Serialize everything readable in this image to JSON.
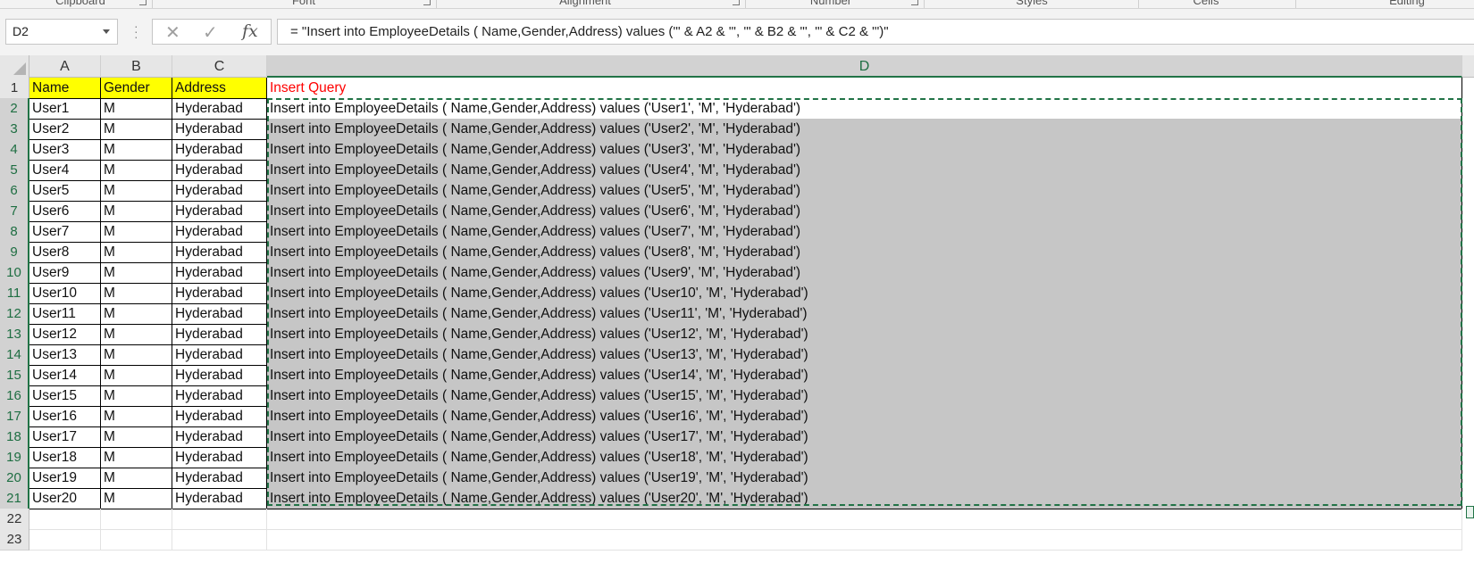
{
  "ribbon": {
    "groups": [
      "Clipboard",
      "Font",
      "Alignment",
      "Number",
      "Styles",
      "Cells",
      "Editing"
    ]
  },
  "formula_bar": {
    "name_box": "D2",
    "cancel_icon": "✕",
    "enter_icon": "✓",
    "fx_label": "fx",
    "formula": "= \"Insert into EmployeeDetails ( Name,Gender,Address) values ('\" & A2 & \"', '\" & B2 & \"', '\" & C2 & \"')\""
  },
  "columns": [
    "A",
    "B",
    "C",
    "D"
  ],
  "header_row": {
    "number": "1",
    "a": "Name",
    "b": "Gender",
    "c": "Address",
    "d": "Insert Query"
  },
  "rows": [
    {
      "n": "2",
      "a": "User1",
      "b": "M",
      "c": "Hyderabad",
      "d": "Insert into EmployeeDetails ( Name,Gender,Address) values ('User1', 'M', 'Hyderabad')"
    },
    {
      "n": "3",
      "a": "User2",
      "b": "M",
      "c": "Hyderabad",
      "d": "Insert into EmployeeDetails ( Name,Gender,Address) values ('User2', 'M', 'Hyderabad')"
    },
    {
      "n": "4",
      "a": "User3",
      "b": "M",
      "c": "Hyderabad",
      "d": "Insert into EmployeeDetails ( Name,Gender,Address) values ('User3', 'M', 'Hyderabad')"
    },
    {
      "n": "5",
      "a": "User4",
      "b": "M",
      "c": "Hyderabad",
      "d": "Insert into EmployeeDetails ( Name,Gender,Address) values ('User4', 'M', 'Hyderabad')"
    },
    {
      "n": "6",
      "a": "User5",
      "b": "M",
      "c": "Hyderabad",
      "d": "Insert into EmployeeDetails ( Name,Gender,Address) values ('User5', 'M', 'Hyderabad')"
    },
    {
      "n": "7",
      "a": "User6",
      "b": "M",
      "c": "Hyderabad",
      "d": "Insert into EmployeeDetails ( Name,Gender,Address) values ('User6', 'M', 'Hyderabad')"
    },
    {
      "n": "8",
      "a": "User7",
      "b": "M",
      "c": "Hyderabad",
      "d": "Insert into EmployeeDetails ( Name,Gender,Address) values ('User7', 'M', 'Hyderabad')"
    },
    {
      "n": "9",
      "a": "User8",
      "b": "M",
      "c": "Hyderabad",
      "d": "Insert into EmployeeDetails ( Name,Gender,Address) values ('User8', 'M', 'Hyderabad')"
    },
    {
      "n": "10",
      "a": "User9",
      "b": "M",
      "c": "Hyderabad",
      "d": "Insert into EmployeeDetails ( Name,Gender,Address) values ('User9', 'M', 'Hyderabad')"
    },
    {
      "n": "11",
      "a": "User10",
      "b": "M",
      "c": "Hyderabad",
      "d": "Insert into EmployeeDetails ( Name,Gender,Address) values ('User10', 'M', 'Hyderabad')"
    },
    {
      "n": "12",
      "a": "User11",
      "b": "M",
      "c": "Hyderabad",
      "d": "Insert into EmployeeDetails ( Name,Gender,Address) values ('User11', 'M', 'Hyderabad')"
    },
    {
      "n": "13",
      "a": "User12",
      "b": "M",
      "c": "Hyderabad",
      "d": "Insert into EmployeeDetails ( Name,Gender,Address) values ('User12', 'M', 'Hyderabad')"
    },
    {
      "n": "14",
      "a": "User13",
      "b": "M",
      "c": "Hyderabad",
      "d": "Insert into EmployeeDetails ( Name,Gender,Address) values ('User13', 'M', 'Hyderabad')"
    },
    {
      "n": "15",
      "a": "User14",
      "b": "M",
      "c": "Hyderabad",
      "d": "Insert into EmployeeDetails ( Name,Gender,Address) values ('User14', 'M', 'Hyderabad')"
    },
    {
      "n": "16",
      "a": "User15",
      "b": "M",
      "c": "Hyderabad",
      "d": "Insert into EmployeeDetails ( Name,Gender,Address) values ('User15', 'M', 'Hyderabad')"
    },
    {
      "n": "17",
      "a": "User16",
      "b": "M",
      "c": "Hyderabad",
      "d": "Insert into EmployeeDetails ( Name,Gender,Address) values ('User16', 'M', 'Hyderabad')"
    },
    {
      "n": "18",
      "a": "User17",
      "b": "M",
      "c": "Hyderabad",
      "d": "Insert into EmployeeDetails ( Name,Gender,Address) values ('User17', 'M', 'Hyderabad')"
    },
    {
      "n": "19",
      "a": "User18",
      "b": "M",
      "c": "Hyderabad",
      "d": "Insert into EmployeeDetails ( Name,Gender,Address) values ('User18', 'M', 'Hyderabad')"
    },
    {
      "n": "20",
      "a": "User19",
      "b": "M",
      "c": "Hyderabad",
      "d": "Insert into EmployeeDetails ( Name,Gender,Address) values ('User19', 'M', 'Hyderabad')"
    },
    {
      "n": "21",
      "a": "User20",
      "b": "M",
      "c": "Hyderabad",
      "d": "Insert into EmployeeDetails ( Name,Gender,Address) values ('User20', 'M', 'Hyderabad')"
    }
  ],
  "empty_rows": [
    "22",
    "23"
  ],
  "colors": {
    "header_fill": "#ffff00",
    "query_header_text": "#ff0000",
    "selection_fill": "#c6c6c6",
    "accent_green": "#217346"
  }
}
